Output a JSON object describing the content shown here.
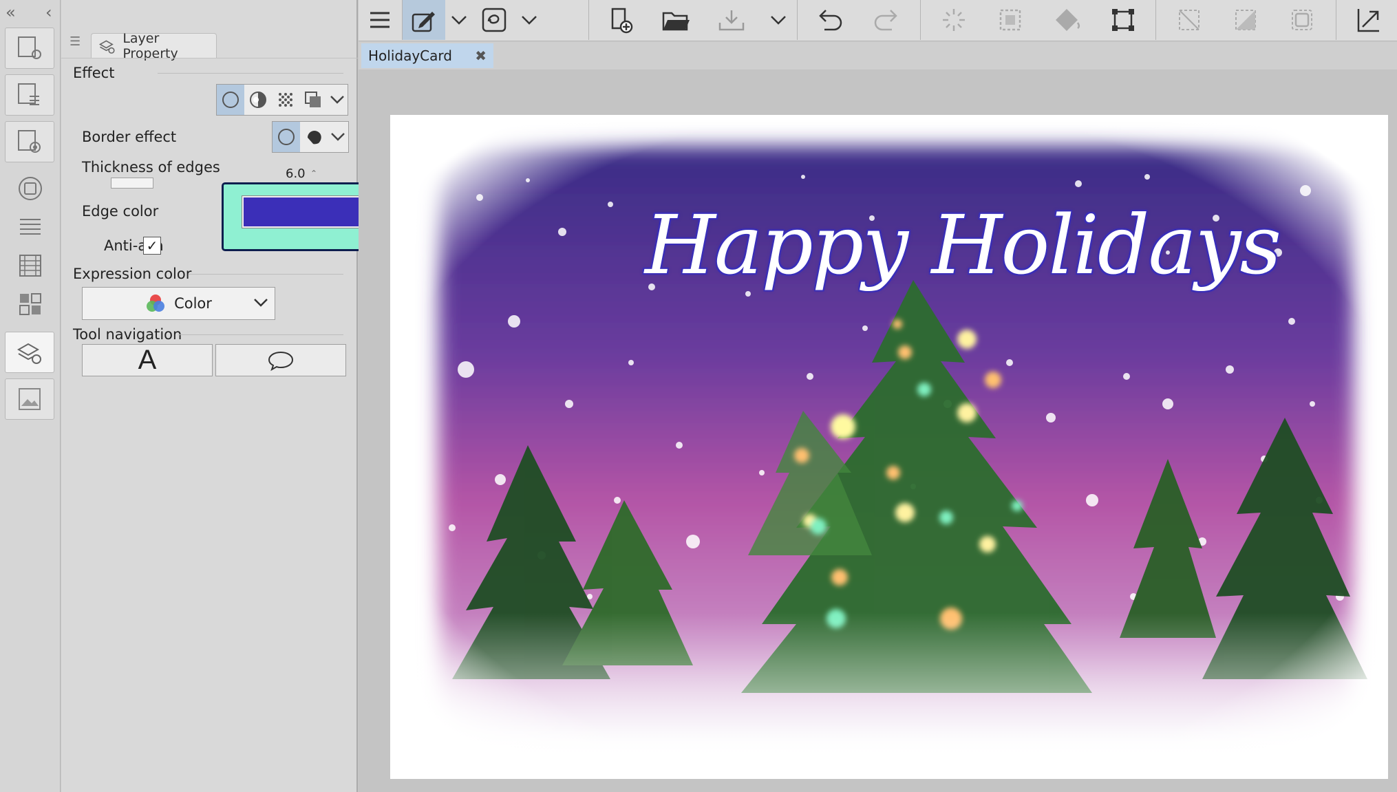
{
  "left_strip": {
    "collapse_glyph": "«",
    "back_glyph": "‹",
    "buttons": [
      "sub-tool-detail-icon",
      "layer-search-icon",
      "navigator-icon",
      "color-circle-icon",
      "layer-list-icon",
      "timeline-icon",
      "material-icon",
      "layer-property-icon",
      "gallery-icon"
    ]
  },
  "panel": {
    "tab_title": "Layer Property",
    "effect_heading": "Effect",
    "border_effect_label": "Border effect",
    "thickness_label": "Thickness of edges",
    "thickness_value": "6.0",
    "edge_color_label": "Edge color",
    "edge_color": "#3b2fb8",
    "antialias_label": "Anti-alia",
    "antialias_checked": true,
    "expression_heading": "Expression color",
    "expression_value": "Color",
    "tool_nav_heading": "Tool navigation",
    "tool_nav_text_glyph": "A"
  },
  "toolbar": {
    "buttons": [
      "menu-icon",
      "pen-tool-icon",
      "chevron-down-icon",
      "lasso-icon",
      "chevron-down-icon",
      "new-file-icon",
      "open-folder-icon",
      "save-icon",
      "chevron-down-icon",
      "undo-icon",
      "redo-icon",
      "loading-icon",
      "selection-icon",
      "fill-icon",
      "transform-icon",
      "deselect-icon",
      "invert-selection-icon",
      "selection-border-icon",
      "expand-icon"
    ]
  },
  "document": {
    "tab_name": "HolidayCard",
    "close_glyph": "✖",
    "card_title": "Happy Holidays"
  },
  "colors": {
    "accent_highlight": "#8ff0d2",
    "selected_segment": "#b3c8de",
    "doc_tab": "#c0d6ec",
    "edge_color": "#3b2fb8"
  }
}
